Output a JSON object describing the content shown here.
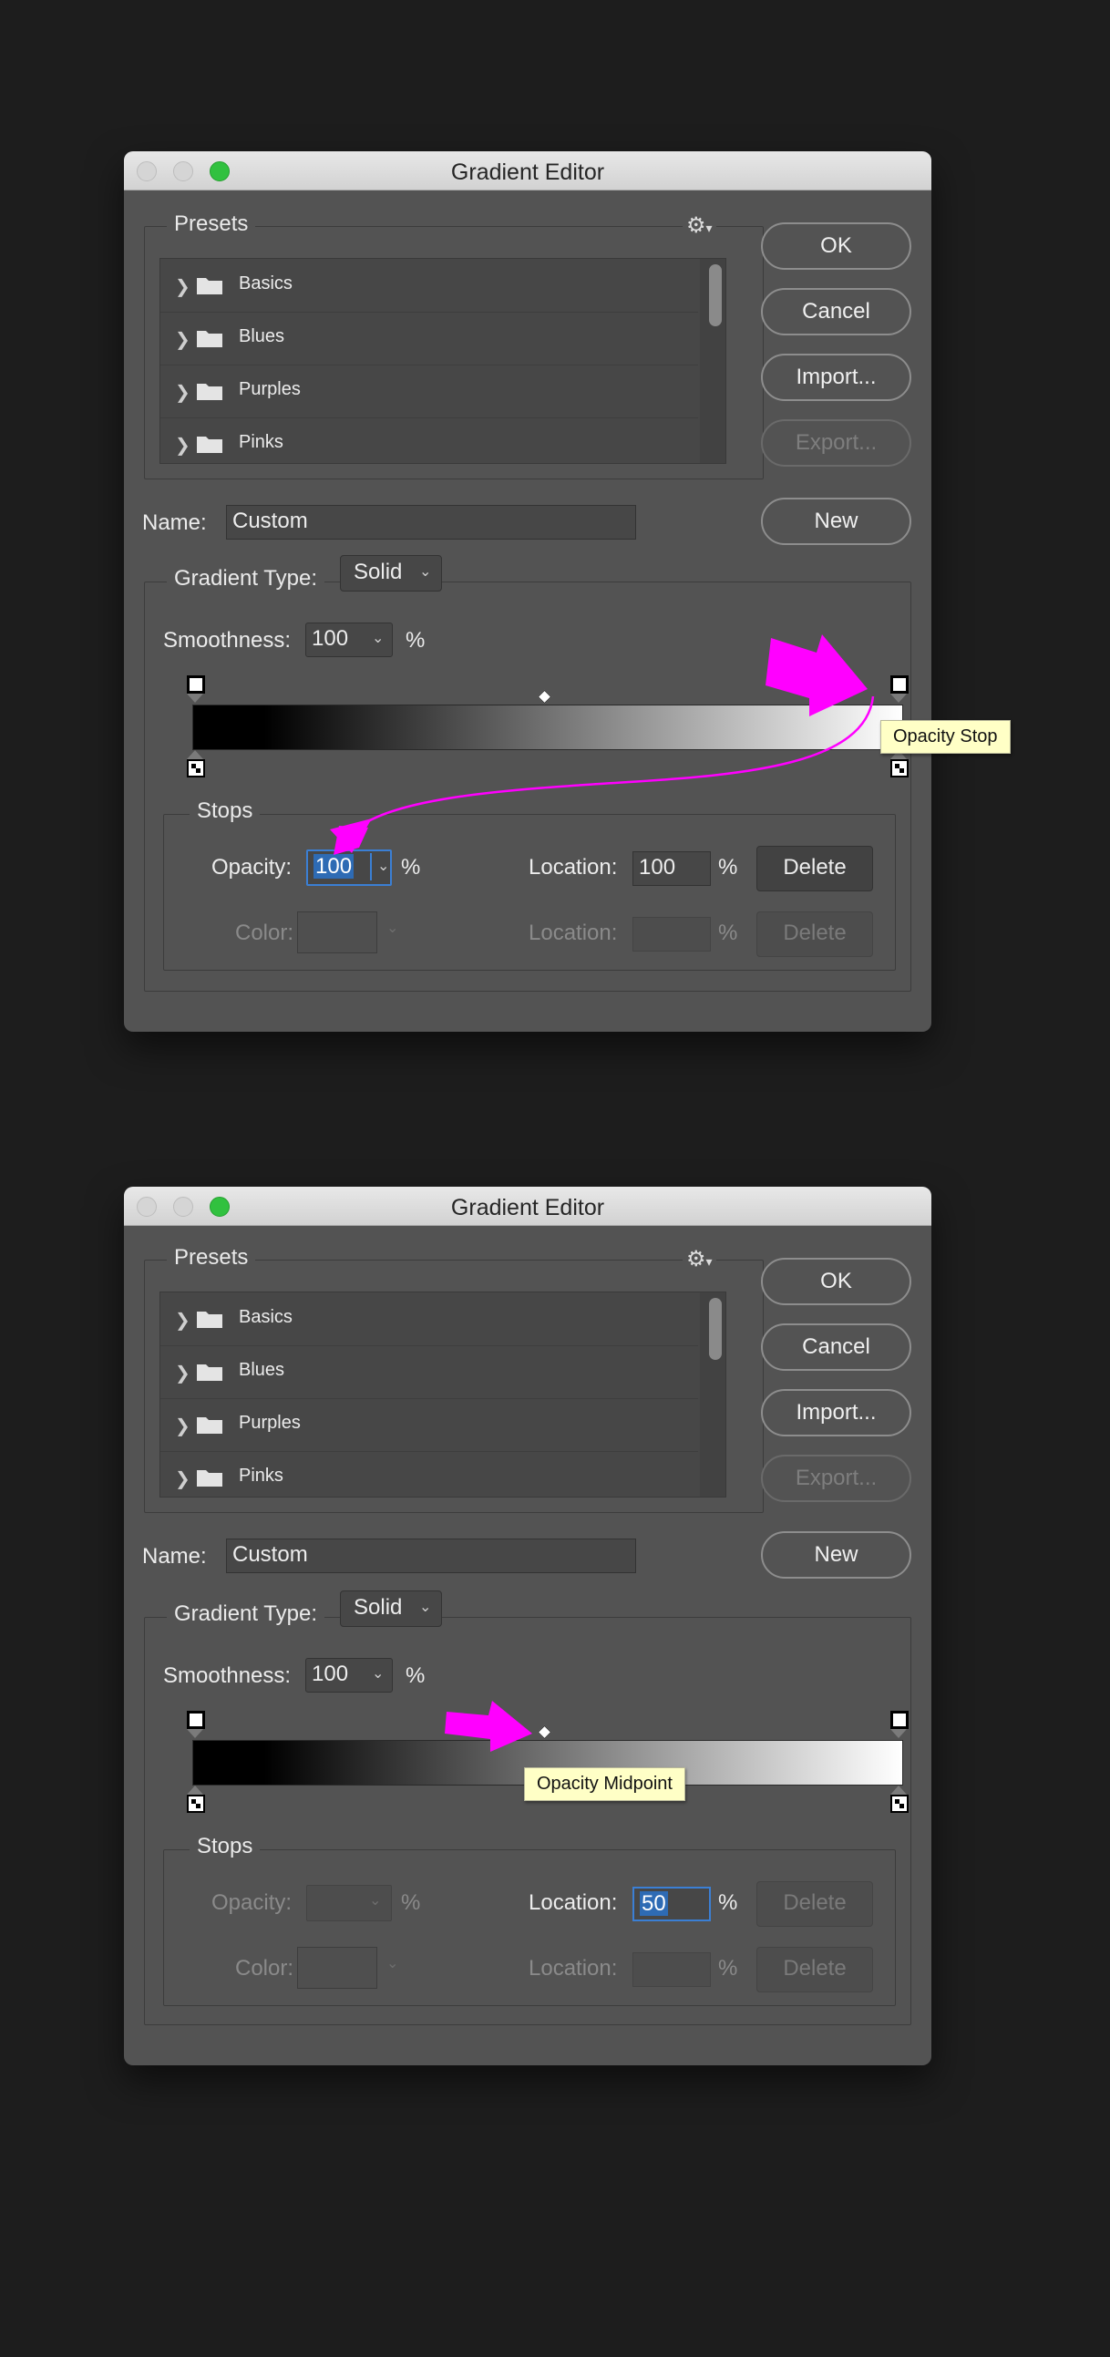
{
  "colors": {
    "annotation": "#ff00ff",
    "tooltip_bg": "#ffffc6",
    "zoom_light": "#31c13f"
  },
  "dialogs": [
    {
      "title": "Gradient Editor",
      "presets_label": "Presets",
      "presets_menu_icon": "gear-icon",
      "presets": [
        "Basics",
        "Blues",
        "Purples",
        "Pinks"
      ],
      "buttons": {
        "ok": "OK",
        "cancel": "Cancel",
        "import": "Import...",
        "export": "Export...",
        "new": "New"
      },
      "name_label": "Name:",
      "name_value": "Custom",
      "gradient_type_label": "Gradient Type:",
      "gradient_type_value": "Solid",
      "smoothness_label": "Smoothness:",
      "smoothness_value": "100",
      "percent": "%",
      "stops_label": "Stops",
      "opacity_label": "Opacity:",
      "opacity_value": "100",
      "opacity_location_label": "Location:",
      "opacity_location_value": "100",
      "opacity_delete": "Delete",
      "color_label": "Color:",
      "color_location_label": "Location:",
      "color_location_value": "",
      "color_delete": "Delete",
      "tooltip": "Opacity Stop"
    },
    {
      "title": "Gradient Editor",
      "presets_label": "Presets",
      "presets_menu_icon": "gear-icon",
      "presets": [
        "Basics",
        "Blues",
        "Purples",
        "Pinks"
      ],
      "buttons": {
        "ok": "OK",
        "cancel": "Cancel",
        "import": "Import...",
        "export": "Export...",
        "new": "New"
      },
      "name_label": "Name:",
      "name_value": "Custom",
      "gradient_type_label": "Gradient Type:",
      "gradient_type_value": "Solid",
      "smoothness_label": "Smoothness:",
      "smoothness_value": "100",
      "percent": "%",
      "stops_label": "Stops",
      "opacity_label": "Opacity:",
      "opacity_value": "",
      "opacity_location_label": "Location:",
      "opacity_location_value": "50",
      "opacity_delete": "Delete",
      "color_label": "Color:",
      "color_location_label": "Location:",
      "color_location_value": "",
      "color_delete": "Delete",
      "tooltip": "Opacity Midpoint"
    }
  ]
}
